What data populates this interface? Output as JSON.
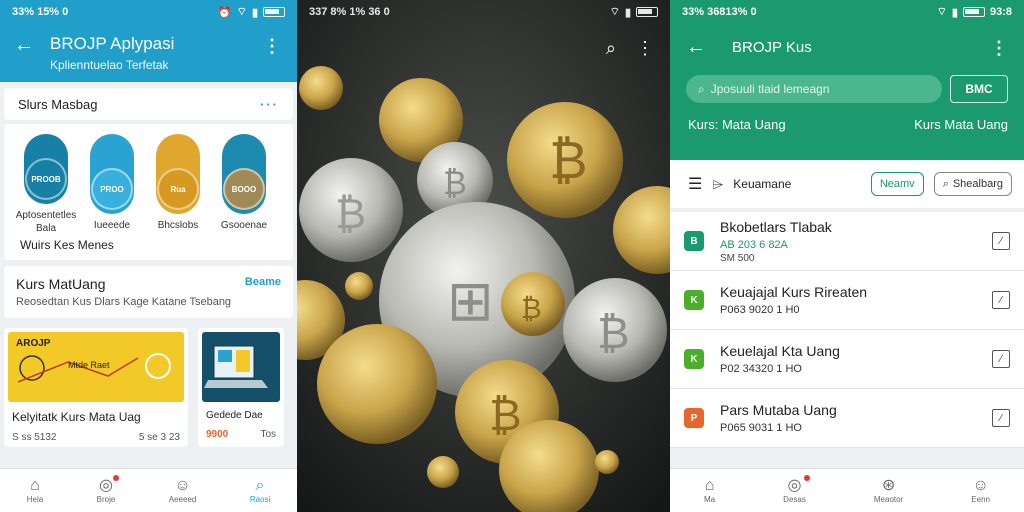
{
  "left": {
    "status": {
      "time": "33% 15% 0",
      "icons": [
        "alarm-icon",
        "wifi-icon",
        "signal-icon",
        "battery-icon"
      ]
    },
    "title": "BROJP Aplypasi",
    "subtitle": "Kplienntuelao Terfetak",
    "section1": {
      "title": "Slurs Masbag",
      "more": "···"
    },
    "coins": [
      {
        "label": "PROOB",
        "caption": "Aptosentetles",
        "caption2": "Bala",
        "color": "#1780a6",
        "disc": "#1680a5"
      },
      {
        "label": "PROO",
        "caption": "Iueeede",
        "color": "#2aa3d3",
        "disc": "#38b0de"
      },
      {
        "label": "Rua",
        "caption": "Bhcslobs",
        "color": "#e0a72f",
        "disc": "#d69a22"
      },
      {
        "label": "BOOO",
        "caption": "Gsooenae",
        "color": "#1d8bb0",
        "disc": "#a08a55"
      }
    ],
    "more_link": "Wuirs Kes Menes",
    "kurs": {
      "title": "Kurs MatUang",
      "link": "Beame",
      "sub": "Reosedtan Kus Dlars Kage Katane Tsebang"
    },
    "tiles": [
      {
        "top": "AROJP",
        "mid": "Mtde Raet",
        "caption": "Kelyitatk Kurs Mata Uag",
        "meta_l": "S ss 5132",
        "meta_r": "5 se 3 23"
      },
      {
        "caption": "Gedede Dae",
        "meta_l": "Tos",
        "meta_r": "9900"
      }
    ],
    "nav": [
      {
        "icon": "home-icon",
        "label": "Hela"
      },
      {
        "icon": "alert-icon",
        "label": "Broje",
        "badge": true
      },
      {
        "icon": "person-icon",
        "label": "Aeeeed"
      },
      {
        "icon": "search-icon",
        "label": "Raosi",
        "active": true
      }
    ]
  },
  "mid": {
    "status": {
      "time": "337 8% 1% 36 0",
      "icons": [
        "wifi-icon",
        "signal-icon",
        "battery-icon"
      ]
    }
  },
  "right": {
    "status": {
      "time": "33% 36813% 0",
      "time2": "93:8",
      "icons": [
        "wifi-icon",
        "signal-icon",
        "battery-icon"
      ]
    },
    "title": "BROJP Kus",
    "search": {
      "placeholder": "Jposuuli tlaid lemeagn",
      "button": "BMC"
    },
    "kurs_left": "Kurs: Mata Uang",
    "kurs_right": "Kurs Mata Uang",
    "filter": {
      "label": "Keuamane",
      "chip1": "Neamv",
      "chip2": "Shealbarg"
    },
    "rows": [
      {
        "name": "Bkobetlars Tlabak",
        "l2": "AB 203 6 82A",
        "l3": "SM 500",
        "color": "#1a9a6e",
        "letter": "B",
        "l2color": "#1a9a6e"
      },
      {
        "name": "Keuajajal Kurs Rireaten",
        "l2": "P063 9020 1 H0",
        "color": "#4caf2a",
        "letter": "K",
        "l2color": "#333"
      },
      {
        "name": "Keuelajal Kta Uang",
        "l2": "P02 34320 1 HO",
        "color": "#4caf2a",
        "letter": "K",
        "l2color": "#333"
      },
      {
        "name": "Pars Mutaba Uang",
        "l2": "P065 9031 1 HO",
        "color": "#e8662a",
        "letter": "P",
        "l2color": "#333"
      }
    ],
    "nav": [
      {
        "icon": "home-icon",
        "label": "Ma"
      },
      {
        "icon": "alert-icon",
        "label": "Desas",
        "badge": true
      },
      {
        "icon": "globe-icon",
        "label": "Meaotor"
      },
      {
        "icon": "person-icon",
        "label": "Eenn"
      }
    ]
  }
}
